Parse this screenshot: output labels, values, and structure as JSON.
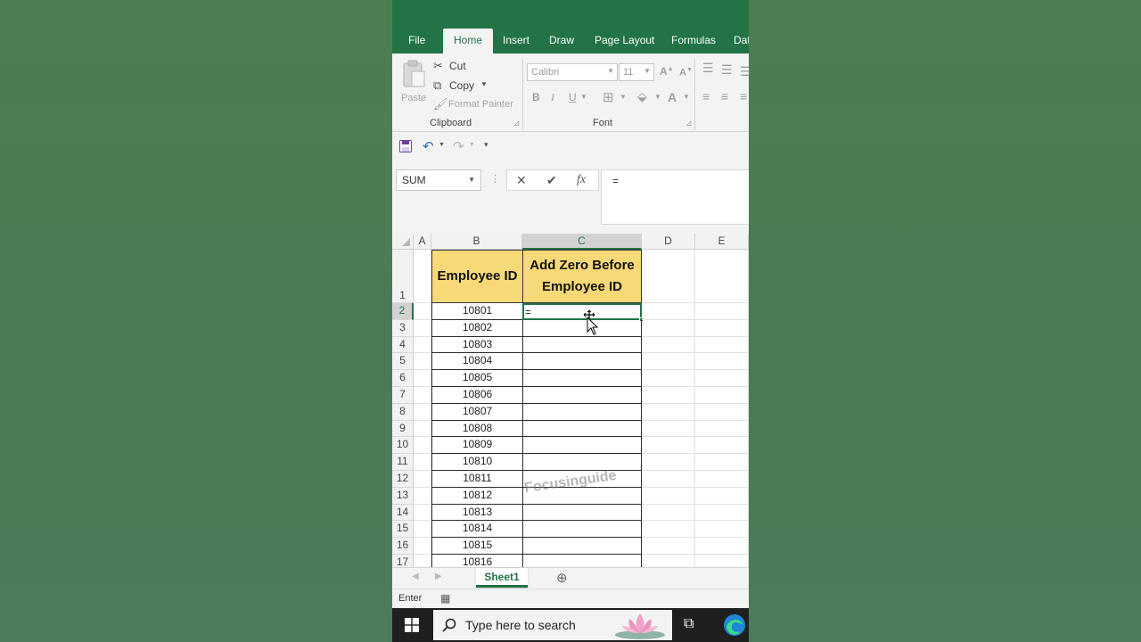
{
  "tabs": [
    "File",
    "Home",
    "Insert",
    "Draw",
    "Page Layout",
    "Formulas",
    "Dat"
  ],
  "active_tab": "Home",
  "ribbon": {
    "clipboard": {
      "paste_label": "Paste",
      "cut_label": "Cut",
      "copy_label": "Copy",
      "format_painter_label": "Format Painter",
      "group_label": "Clipboard"
    },
    "font": {
      "font_name": "Calibri",
      "font_size": "11",
      "group_label": "Font"
    }
  },
  "formula_bar": {
    "name_box": "SUM",
    "formula": "="
  },
  "columns": [
    "A",
    "B",
    "C",
    "D",
    "E"
  ],
  "selected_column": "C",
  "header_row": {
    "row_number": "1",
    "employee_id": "Employee ID",
    "add_zero": "Add Zero Before Employee ID"
  },
  "rows": [
    {
      "n": "2",
      "id": "10801"
    },
    {
      "n": "3",
      "id": "10802"
    },
    {
      "n": "4",
      "id": "10803"
    },
    {
      "n": "5",
      "id": "10804"
    },
    {
      "n": "6",
      "id": "10805"
    },
    {
      "n": "7",
      "id": "10806"
    },
    {
      "n": "8",
      "id": "10807"
    },
    {
      "n": "9",
      "id": "10808"
    },
    {
      "n": "10",
      "id": "10809"
    },
    {
      "n": "11",
      "id": "10810"
    },
    {
      "n": "12",
      "id": "10811"
    },
    {
      "n": "13",
      "id": "10812"
    },
    {
      "n": "14",
      "id": "10813"
    },
    {
      "n": "15",
      "id": "10814"
    },
    {
      "n": "16",
      "id": "10815"
    },
    {
      "n": "17",
      "id": "10816"
    }
  ],
  "active_cell_value": "=",
  "watermark": "Focusinguide",
  "sheet_tab": "Sheet1",
  "status_mode": "Enter",
  "taskbar": {
    "search_placeholder": "Type here to search"
  },
  "colors": {
    "excel_green": "#227346",
    "header_fill": "#f8d978",
    "background": "#4a7c55"
  }
}
